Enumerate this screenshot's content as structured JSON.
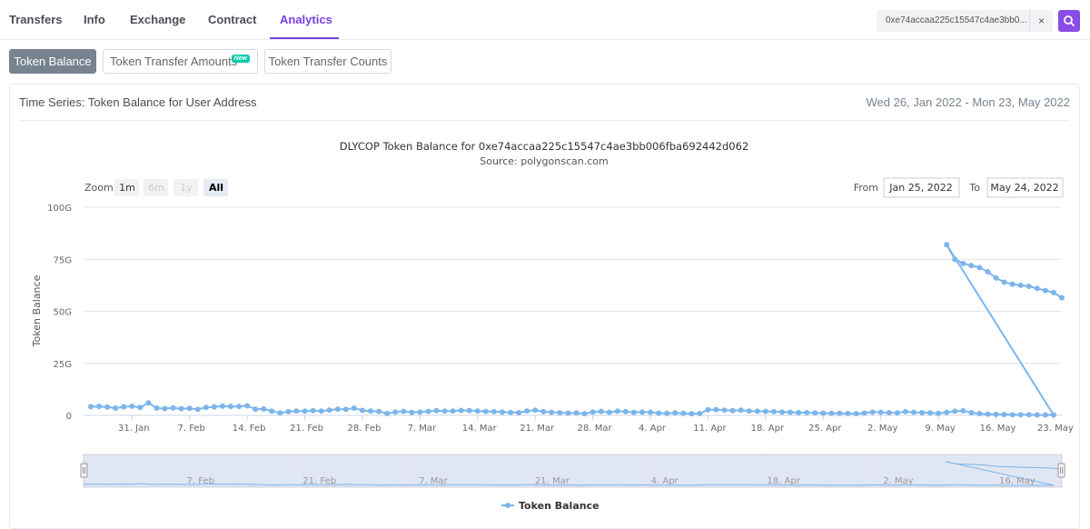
{
  "nav": {
    "tabs": [
      {
        "label": "Transfers"
      },
      {
        "label": "Info"
      },
      {
        "label": "Exchange"
      },
      {
        "label": "Contract"
      },
      {
        "label": "Analytics"
      }
    ],
    "search_value": "0xe74accaa225c15547c4ae3bb0...",
    "clear_label": "×"
  },
  "subtabs": [
    {
      "label": "Token Balance"
    },
    {
      "label": "Token Transfer Amounts",
      "badge": "New"
    },
    {
      "label": "Token Transfer Counts"
    }
  ],
  "card": {
    "title": "Time Series: Token Balance for User Address",
    "range": "Wed 26, Jan 2022 - Mon 23, May 2022"
  },
  "zoom": {
    "label": "Zoom",
    "buttons": [
      "1m",
      "6m",
      "1y",
      "All"
    ],
    "from_label": "From",
    "from_value": "Jan 25, 2022",
    "to_label": "To",
    "to_value": "May 24, 2022"
  },
  "colors": {
    "accent": "#7b3fe4",
    "series": "#7cb5ec",
    "navigator_fill": "#ccd6eb"
  },
  "chart_data": {
    "type": "line",
    "title": "DLYCOP Token Balance for 0xe74accaa225c15547c4ae3bb006fba692442d062",
    "subtitle": "Source: polygonscan.com",
    "ylabel": "Token Balance",
    "xlabel": "",
    "ylim": [
      0,
      100
    ],
    "y_unit": "G",
    "y_ticks": [
      "0",
      "25G",
      "50G",
      "75G",
      "100G"
    ],
    "x_ticks": [
      "31. Jan",
      "7. Feb",
      "14. Feb",
      "21. Feb",
      "28. Feb",
      "7. Mar",
      "14. Mar",
      "21. Mar",
      "28. Mar",
      "4. Apr",
      "11. Apr",
      "18. Apr",
      "25. Apr",
      "2. May",
      "9. May",
      "16. May",
      "23. May"
    ],
    "navigator_ticks": [
      "7. Feb",
      "21. Feb",
      "7. Mar",
      "21. Mar",
      "4. Apr",
      "18. Apr",
      "2. May",
      "16. May"
    ],
    "legend": "Token Balance",
    "legend_position": "bottom-center",
    "grid": true,
    "series": [
      {
        "name": "Token Balance",
        "x": [
          "2022-01-26",
          "2022-01-27",
          "2022-01-28",
          "2022-01-29",
          "2022-01-30",
          "2022-01-31",
          "2022-02-01",
          "2022-02-02",
          "2022-02-03",
          "2022-02-04",
          "2022-02-05",
          "2022-02-06",
          "2022-02-07",
          "2022-02-08",
          "2022-02-09",
          "2022-02-10",
          "2022-02-11",
          "2022-02-12",
          "2022-02-13",
          "2022-02-14",
          "2022-02-15",
          "2022-02-16",
          "2022-02-17",
          "2022-02-18",
          "2022-02-19",
          "2022-02-20",
          "2022-02-21",
          "2022-02-22",
          "2022-02-23",
          "2022-02-24",
          "2022-02-25",
          "2022-02-26",
          "2022-02-27",
          "2022-02-28",
          "2022-03-01",
          "2022-03-02",
          "2022-03-03",
          "2022-03-04",
          "2022-03-05",
          "2022-03-06",
          "2022-03-07",
          "2022-03-08",
          "2022-03-09",
          "2022-03-10",
          "2022-03-11",
          "2022-03-12",
          "2022-03-13",
          "2022-03-14",
          "2022-03-15",
          "2022-03-16",
          "2022-03-17",
          "2022-03-18",
          "2022-03-19",
          "2022-03-20",
          "2022-03-21",
          "2022-03-22",
          "2022-03-23",
          "2022-03-24",
          "2022-03-25",
          "2022-03-26",
          "2022-03-27",
          "2022-03-28",
          "2022-03-29",
          "2022-03-30",
          "2022-03-31",
          "2022-04-01",
          "2022-04-02",
          "2022-04-03",
          "2022-04-04",
          "2022-04-05",
          "2022-04-06",
          "2022-04-07",
          "2022-04-08",
          "2022-04-09",
          "2022-04-10",
          "2022-04-11",
          "2022-04-12",
          "2022-04-13",
          "2022-04-14",
          "2022-04-15",
          "2022-04-16",
          "2022-04-17",
          "2022-04-18",
          "2022-04-19",
          "2022-04-20",
          "2022-04-21",
          "2022-04-22",
          "2022-04-23",
          "2022-04-24",
          "2022-04-25",
          "2022-04-26",
          "2022-04-27",
          "2022-04-28",
          "2022-04-29",
          "2022-04-30",
          "2022-05-01",
          "2022-05-02",
          "2022-05-03",
          "2022-05-04",
          "2022-05-05",
          "2022-05-06",
          "2022-05-07",
          "2022-05-08",
          "2022-05-09",
          "2022-05-10",
          "2022-05-11",
          "2022-05-12",
          "2022-05-13",
          "2022-05-14",
          "2022-05-15",
          "2022-05-16",
          "2022-05-17",
          "2022-05-18",
          "2022-05-19",
          "2022-05-20",
          "2022-05-21",
          "2022-05-22",
          "2022-05-23"
        ],
        "values": [
          4.2,
          4.3,
          4.0,
          3.5,
          4.1,
          4.4,
          3.8,
          6.0,
          3.5,
          3.3,
          3.6,
          3.2,
          3.4,
          2.9,
          3.8,
          4.1,
          4.4,
          4.3,
          4.3,
          4.6,
          3.0,
          3.1,
          2.0,
          1.2,
          1.8,
          2.1,
          2.0,
          2.3,
          2.1,
          2.5,
          3.0,
          2.9,
          3.5,
          2.4,
          2.1,
          1.9,
          0.9,
          1.6,
          1.9,
          1.4,
          1.6,
          1.9,
          2.3,
          2.0,
          2.1,
          2.4,
          2.3,
          2.1,
          1.9,
          1.8,
          1.6,
          1.4,
          1.3,
          2.1,
          2.5,
          1.8,
          1.5,
          1.3,
          1.1,
          1.2,
          0.8,
          1.6,
          1.9,
          1.5,
          2.0,
          1.8,
          1.4,
          1.6,
          1.5,
          1.1,
          1.0,
          1.2,
          1.0,
          0.8,
          0.9,
          2.7,
          2.8,
          2.5,
          2.3,
          2.5,
          2.1,
          2.0,
          1.9,
          1.8,
          1.6,
          1.5,
          1.3,
          1.3,
          1.2,
          1.1,
          1.0,
          1.0,
          0.9,
          0.8,
          1.1,
          1.6,
          1.5,
          1.3,
          1.2,
          1.8,
          1.5,
          1.3,
          1.2,
          1.0,
          1.4,
          2.0,
          2.2,
          1.3,
          0.8,
          0.6,
          0.5,
          0.4,
          0.3,
          0.3,
          0.3,
          0.2,
          0.2,
          0.2
        ]
      }
    ],
    "tail": {
      "x": [
        "2022-05-10",
        "2022-05-11",
        "2022-05-12",
        "2022-05-13",
        "2022-05-14",
        "2022-05-15",
        "2022-05-16",
        "2022-05-17",
        "2022-05-18",
        "2022-05-19",
        "2022-05-20",
        "2022-05-21",
        "2022-05-22",
        "2022-05-23",
        "2022-05-24"
      ],
      "values": [
        82.0,
        75.0,
        73.0,
        72.0,
        71.0,
        69.0,
        66.0,
        64.0,
        63.0,
        62.5,
        62.0,
        61.0,
        60.0,
        59.0,
        56.5
      ]
    }
  }
}
